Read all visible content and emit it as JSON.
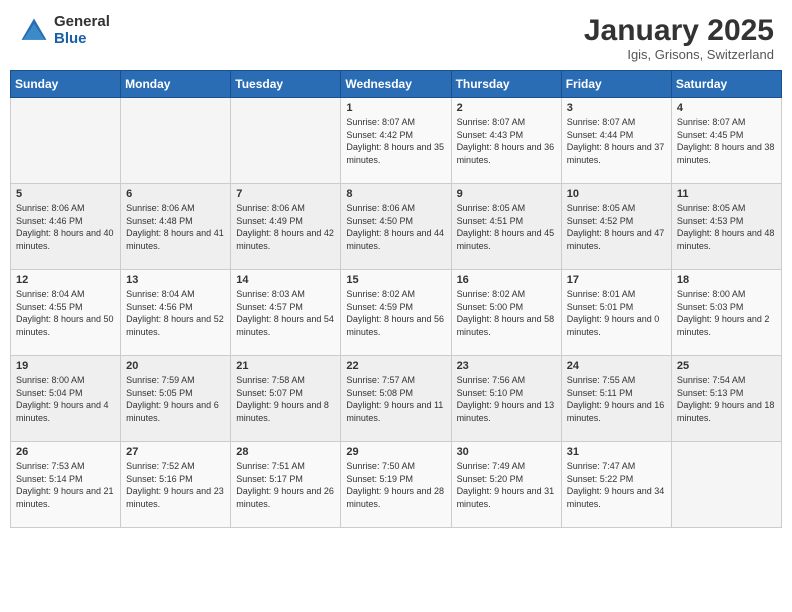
{
  "logo": {
    "general": "General",
    "blue": "Blue"
  },
  "header": {
    "month": "January 2025",
    "location": "Igis, Grisons, Switzerland"
  },
  "weekdays": [
    "Sunday",
    "Monday",
    "Tuesday",
    "Wednesday",
    "Thursday",
    "Friday",
    "Saturday"
  ],
  "weeks": [
    [
      {
        "day": "",
        "sunrise": "",
        "sunset": "",
        "daylight": ""
      },
      {
        "day": "",
        "sunrise": "",
        "sunset": "",
        "daylight": ""
      },
      {
        "day": "",
        "sunrise": "",
        "sunset": "",
        "daylight": ""
      },
      {
        "day": "1",
        "sunrise": "Sunrise: 8:07 AM",
        "sunset": "Sunset: 4:42 PM",
        "daylight": "Daylight: 8 hours and 35 minutes."
      },
      {
        "day": "2",
        "sunrise": "Sunrise: 8:07 AM",
        "sunset": "Sunset: 4:43 PM",
        "daylight": "Daylight: 8 hours and 36 minutes."
      },
      {
        "day": "3",
        "sunrise": "Sunrise: 8:07 AM",
        "sunset": "Sunset: 4:44 PM",
        "daylight": "Daylight: 8 hours and 37 minutes."
      },
      {
        "day": "4",
        "sunrise": "Sunrise: 8:07 AM",
        "sunset": "Sunset: 4:45 PM",
        "daylight": "Daylight: 8 hours and 38 minutes."
      }
    ],
    [
      {
        "day": "5",
        "sunrise": "Sunrise: 8:06 AM",
        "sunset": "Sunset: 4:46 PM",
        "daylight": "Daylight: 8 hours and 40 minutes."
      },
      {
        "day": "6",
        "sunrise": "Sunrise: 8:06 AM",
        "sunset": "Sunset: 4:48 PM",
        "daylight": "Daylight: 8 hours and 41 minutes."
      },
      {
        "day": "7",
        "sunrise": "Sunrise: 8:06 AM",
        "sunset": "Sunset: 4:49 PM",
        "daylight": "Daylight: 8 hours and 42 minutes."
      },
      {
        "day": "8",
        "sunrise": "Sunrise: 8:06 AM",
        "sunset": "Sunset: 4:50 PM",
        "daylight": "Daylight: 8 hours and 44 minutes."
      },
      {
        "day": "9",
        "sunrise": "Sunrise: 8:05 AM",
        "sunset": "Sunset: 4:51 PM",
        "daylight": "Daylight: 8 hours and 45 minutes."
      },
      {
        "day": "10",
        "sunrise": "Sunrise: 8:05 AM",
        "sunset": "Sunset: 4:52 PM",
        "daylight": "Daylight: 8 hours and 47 minutes."
      },
      {
        "day": "11",
        "sunrise": "Sunrise: 8:05 AM",
        "sunset": "Sunset: 4:53 PM",
        "daylight": "Daylight: 8 hours and 48 minutes."
      }
    ],
    [
      {
        "day": "12",
        "sunrise": "Sunrise: 8:04 AM",
        "sunset": "Sunset: 4:55 PM",
        "daylight": "Daylight: 8 hours and 50 minutes."
      },
      {
        "day": "13",
        "sunrise": "Sunrise: 8:04 AM",
        "sunset": "Sunset: 4:56 PM",
        "daylight": "Daylight: 8 hours and 52 minutes."
      },
      {
        "day": "14",
        "sunrise": "Sunrise: 8:03 AM",
        "sunset": "Sunset: 4:57 PM",
        "daylight": "Daylight: 8 hours and 54 minutes."
      },
      {
        "day": "15",
        "sunrise": "Sunrise: 8:02 AM",
        "sunset": "Sunset: 4:59 PM",
        "daylight": "Daylight: 8 hours and 56 minutes."
      },
      {
        "day": "16",
        "sunrise": "Sunrise: 8:02 AM",
        "sunset": "Sunset: 5:00 PM",
        "daylight": "Daylight: 8 hours and 58 minutes."
      },
      {
        "day": "17",
        "sunrise": "Sunrise: 8:01 AM",
        "sunset": "Sunset: 5:01 PM",
        "daylight": "Daylight: 9 hours and 0 minutes."
      },
      {
        "day": "18",
        "sunrise": "Sunrise: 8:00 AM",
        "sunset": "Sunset: 5:03 PM",
        "daylight": "Daylight: 9 hours and 2 minutes."
      }
    ],
    [
      {
        "day": "19",
        "sunrise": "Sunrise: 8:00 AM",
        "sunset": "Sunset: 5:04 PM",
        "daylight": "Daylight: 9 hours and 4 minutes."
      },
      {
        "day": "20",
        "sunrise": "Sunrise: 7:59 AM",
        "sunset": "Sunset: 5:05 PM",
        "daylight": "Daylight: 9 hours and 6 minutes."
      },
      {
        "day": "21",
        "sunrise": "Sunrise: 7:58 AM",
        "sunset": "Sunset: 5:07 PM",
        "daylight": "Daylight: 9 hours and 8 minutes."
      },
      {
        "day": "22",
        "sunrise": "Sunrise: 7:57 AM",
        "sunset": "Sunset: 5:08 PM",
        "daylight": "Daylight: 9 hours and 11 minutes."
      },
      {
        "day": "23",
        "sunrise": "Sunrise: 7:56 AM",
        "sunset": "Sunset: 5:10 PM",
        "daylight": "Daylight: 9 hours and 13 minutes."
      },
      {
        "day": "24",
        "sunrise": "Sunrise: 7:55 AM",
        "sunset": "Sunset: 5:11 PM",
        "daylight": "Daylight: 9 hours and 16 minutes."
      },
      {
        "day": "25",
        "sunrise": "Sunrise: 7:54 AM",
        "sunset": "Sunset: 5:13 PM",
        "daylight": "Daylight: 9 hours and 18 minutes."
      }
    ],
    [
      {
        "day": "26",
        "sunrise": "Sunrise: 7:53 AM",
        "sunset": "Sunset: 5:14 PM",
        "daylight": "Daylight: 9 hours and 21 minutes."
      },
      {
        "day": "27",
        "sunrise": "Sunrise: 7:52 AM",
        "sunset": "Sunset: 5:16 PM",
        "daylight": "Daylight: 9 hours and 23 minutes."
      },
      {
        "day": "28",
        "sunrise": "Sunrise: 7:51 AM",
        "sunset": "Sunset: 5:17 PM",
        "daylight": "Daylight: 9 hours and 26 minutes."
      },
      {
        "day": "29",
        "sunrise": "Sunrise: 7:50 AM",
        "sunset": "Sunset: 5:19 PM",
        "daylight": "Daylight: 9 hours and 28 minutes."
      },
      {
        "day": "30",
        "sunrise": "Sunrise: 7:49 AM",
        "sunset": "Sunset: 5:20 PM",
        "daylight": "Daylight: 9 hours and 31 minutes."
      },
      {
        "day": "31",
        "sunrise": "Sunrise: 7:47 AM",
        "sunset": "Sunset: 5:22 PM",
        "daylight": "Daylight: 9 hours and 34 minutes."
      },
      {
        "day": "",
        "sunrise": "",
        "sunset": "",
        "daylight": ""
      }
    ]
  ]
}
